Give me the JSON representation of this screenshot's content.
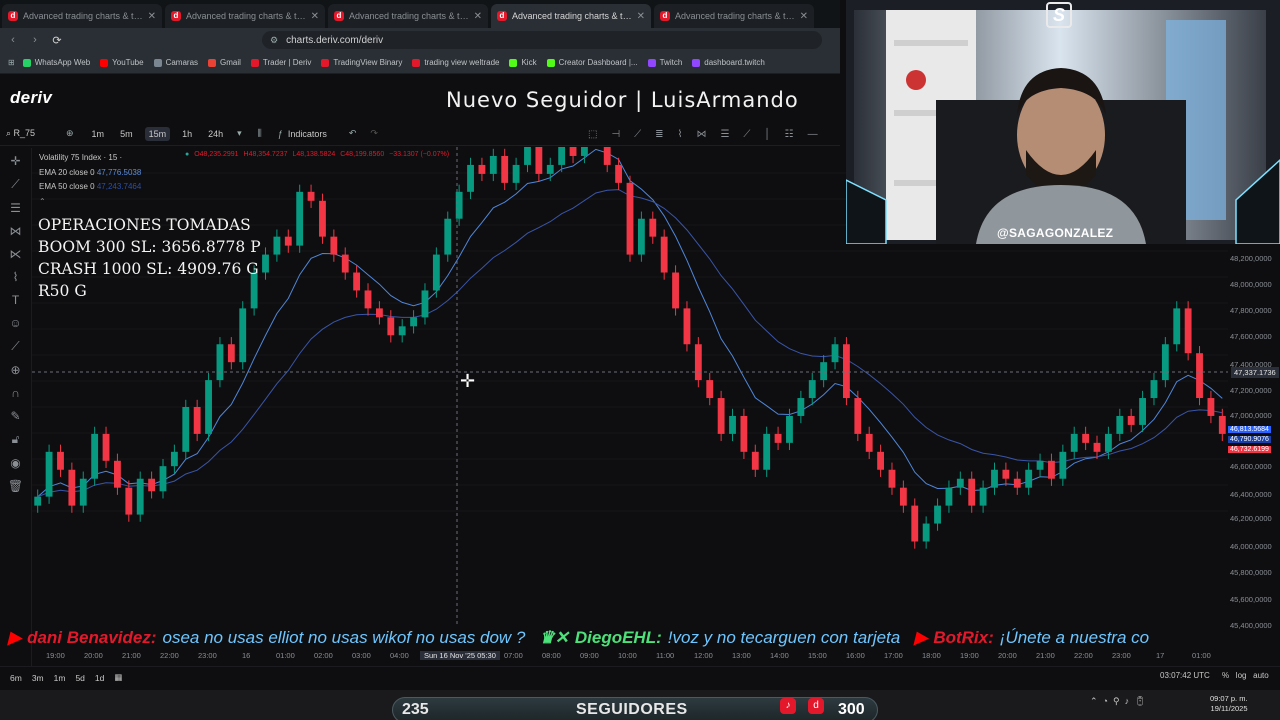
{
  "browser": {
    "tabs": [
      {
        "title": "Advanced trading charts & tools | ",
        "active": false
      },
      {
        "title": "Advanced trading charts & tools | ",
        "active": false
      },
      {
        "title": "Advanced trading charts & tools | ",
        "active": false
      },
      {
        "title": "Advanced trading charts & tool",
        "active": true
      },
      {
        "title": "Advanced trading charts & tools | ",
        "active": false
      }
    ],
    "url": "charts.deriv.com/deriv",
    "bookmarks": [
      {
        "label": "WhatsApp Web",
        "color": "#25d366"
      },
      {
        "label": "YouTube",
        "color": "#ff0000"
      },
      {
        "label": "Camaras",
        "color": "#7a8691"
      },
      {
        "label": "Gmail",
        "color": "#ea4335"
      },
      {
        "label": "Trader | Deriv",
        "color": "#e3192b"
      },
      {
        "label": "TradingView Binary",
        "color": "#e3192b"
      },
      {
        "label": "trading view weltrade",
        "color": "#e3192b"
      },
      {
        "label": "Kick",
        "color": "#53fc18"
      },
      {
        "label": "Creator Dashboard |...",
        "color": "#53fc18"
      },
      {
        "label": "Twitch",
        "color": "#9146ff"
      },
      {
        "label": "dashboard.twitch",
        "color": "#9146ff"
      }
    ]
  },
  "app": {
    "logo": "deriv",
    "banner": "Nuevo Seguidor | LuisArmando"
  },
  "toolbar": {
    "symbol": "R_75",
    "timeframes": [
      "1m",
      "5m",
      "15m",
      "1h",
      "24h"
    ],
    "active_timeframe": "15m",
    "indicators_label": "Indicators"
  },
  "legend": {
    "title": "Volatility 75 Index · 15 ·",
    "o": "O48,235.2991",
    "h": "H48,354.7237",
    "l": "L48,138.5824",
    "c": "C48,199.8560",
    "chg": "−33.1307 (−0.07%)",
    "ema20_label": "EMA 20 close 0",
    "ema20_value": "47,776.5038",
    "ema50_label": "EMA 50 close 0",
    "ema50_value": "47,243.7464"
  },
  "overlay": {
    "line1": "OPERACIONES TOMADAS",
    "line2": "BOOM 300 SL: 3656.8778 P",
    "line3": "CRASH 1000 SL: 4909.76 G",
    "line4": "R50 G"
  },
  "price_axis": {
    "labels": [
      "48,200,0000",
      "48,000,0000",
      "47,800,0000",
      "47,600,0000",
      "47,400,0000",
      "47,200,0000",
      "47,000,0000",
      "46,600,0000",
      "46,400,0000",
      "46,200,0000",
      "46,000,0000",
      "45,800,0000",
      "45,600,0000",
      "45,400,0000"
    ],
    "crosshair": "47,337.1736",
    "tag_ema20": "46,813.5684",
    "tag_ema50": "46,790.9076",
    "tag_last": "46,732.6199"
  },
  "time_axis": {
    "labels": [
      "19:00",
      "20:00",
      "21:00",
      "22:00",
      "23:00",
      "16",
      "01:00",
      "02:00",
      "03:00",
      "04:00",
      "Sun 16 Nov '25  05:30",
      "07:00",
      "08:00",
      "09:00",
      "10:00",
      "11:00",
      "12:00",
      "13:00",
      "14:00",
      "15:00",
      "16:00",
      "17:00",
      "18:00",
      "19:00",
      "20:00",
      "21:00",
      "22:00",
      "23:00",
      "17",
      "01:00"
    ]
  },
  "ticker": {
    "user1": "dani Benavidez:",
    "msg1": "osea no usas elliot no usas wikof no usas dow ?",
    "user2": "DiegoEHL:",
    "msg2": "!voz y no tecarguen con tarjeta",
    "user3": "BotRix:",
    "msg3": "¡Únete a nuestra co"
  },
  "bottom": {
    "periods": [
      "6m",
      "3m",
      "1m",
      "5d",
      "1d"
    ],
    "clock": "03:07:42 UTC",
    "pct": "%",
    "log": "log",
    "auto": "auto"
  },
  "stream": {
    "followers": "235",
    "followers_label": "SEGUIDORES",
    "goal": "300",
    "handle": "@SAGAGONZALEZ",
    "logo": "S"
  },
  "taskbar": {
    "time": "09:07 p. m.",
    "date": "19/11/2025"
  },
  "chart_data": {
    "type": "candlestick",
    "ylim": [
      45400,
      48300
    ],
    "up_color": "#089981",
    "down_color": "#f23645",
    "close": [
      46350,
      46600,
      46500,
      46300,
      46450,
      46700,
      46550,
      46400,
      46250,
      46450,
      46380,
      46520,
      46600,
      46850,
      46700,
      47000,
      47200,
      47100,
      47400,
      47600,
      47700,
      47800,
      47750,
      48050,
      48000,
      47800,
      47700,
      47600,
      47500,
      47400,
      47350,
      47250,
      47300,
      47350,
      47500,
      47700,
      47900,
      48050,
      48200,
      48150,
      48250,
      48100,
      48200,
      48300,
      48150,
      48200,
      48350,
      48250,
      48400,
      48450,
      48200,
      48100,
      47700,
      47900,
      47800,
      47600,
      47400,
      47200,
      47000,
      46900,
      46700,
      46800,
      46600,
      46500,
      46700,
      46650,
      46800,
      46900,
      47000,
      47100,
      47200,
      46900,
      46700,
      46600,
      46500,
      46400,
      46300,
      46100,
      46200,
      46300,
      46400,
      46450,
      46300,
      46400,
      46500,
      46450,
      46400,
      46500,
      46550,
      46450,
      46600,
      46700,
      46650,
      46600,
      46700,
      46800,
      46750,
      46900,
      47000,
      47200,
      47400,
      47150,
      46900,
      46800,
      46700
    ],
    "ema20_label_value": 47776.5038,
    "ema50_label_value": 47243.7464
  }
}
